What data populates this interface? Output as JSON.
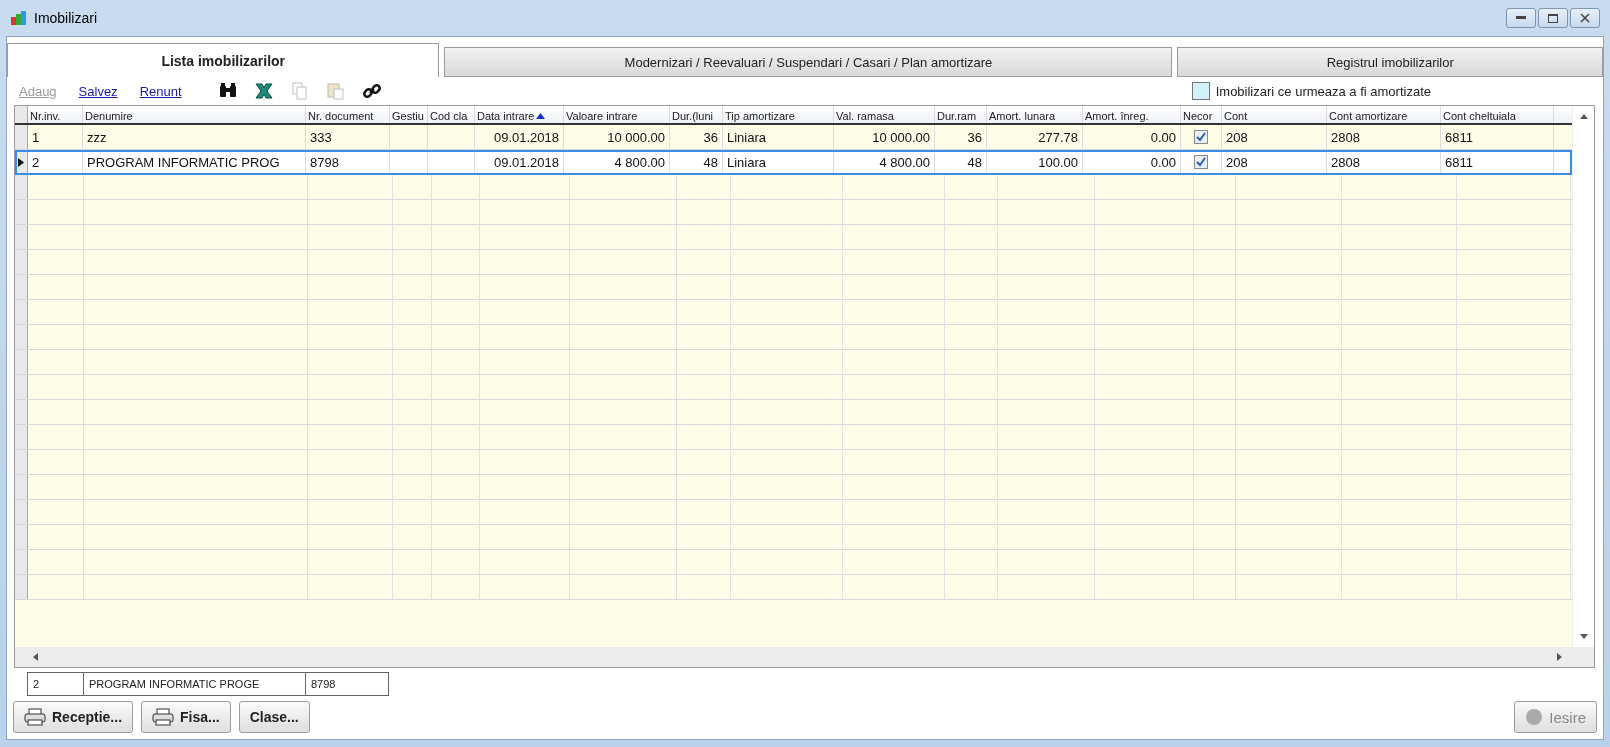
{
  "window": {
    "title": "Imobilizari"
  },
  "tabs": [
    {
      "label": "Lista imobilizarilor",
      "selected": true
    },
    {
      "label": "Modernizari / Reevaluari / Suspendari / Casari / Plan amortizare",
      "selected": false
    },
    {
      "label": "Registrul imobilizarilor",
      "selected": false
    }
  ],
  "toolbar": {
    "links": [
      {
        "label": "Adaug",
        "disabled": true
      },
      {
        "label": "Salvez",
        "disabled": false
      },
      {
        "label": "Renunt",
        "disabled": false
      }
    ],
    "icons": [
      {
        "kind": "binoculars",
        "disabled": false
      },
      {
        "kind": "excel",
        "disabled": false
      },
      {
        "kind": "copy",
        "disabled": true
      },
      {
        "kind": "paste",
        "disabled": true
      },
      {
        "kind": "link",
        "disabled": false
      }
    ],
    "legend": "Imobilizari ce urmeaza a fi amortizate"
  },
  "table": {
    "columns": [
      {
        "label": "Nr.inv.",
        "kind": "text",
        "sorted": false
      },
      {
        "label": "Denumire",
        "kind": "text",
        "sorted": false
      },
      {
        "label": "Nr. document",
        "kind": "text",
        "sorted": false
      },
      {
        "label": "Gestiu",
        "kind": "text",
        "sorted": false
      },
      {
        "label": "Cod cla",
        "kind": "text",
        "sorted": false
      },
      {
        "label": "Data intrare",
        "kind": "number",
        "sorted": true
      },
      {
        "label": "Valoare intrare",
        "kind": "number",
        "sorted": false
      },
      {
        "label": "Dur.(luni",
        "kind": "number",
        "sorted": false
      },
      {
        "label": "Tip amortizare",
        "kind": "text",
        "sorted": false
      },
      {
        "label": "Val. ramasa",
        "kind": "number",
        "sorted": false
      },
      {
        "label": "Dur.ram",
        "kind": "number",
        "sorted": false
      },
      {
        "label": "Amort. lunara",
        "kind": "number",
        "sorted": false
      },
      {
        "label": "Amort. înreg.",
        "kind": "number",
        "sorted": false
      },
      {
        "label": "Necor",
        "kind": "check",
        "sorted": false
      },
      {
        "label": "Cont",
        "kind": "text",
        "sorted": false
      },
      {
        "label": "Cont amortizare",
        "kind": "text",
        "sorted": false
      },
      {
        "label": "Cont cheltuiala",
        "kind": "text",
        "sorted": false
      }
    ],
    "rows": [
      {
        "selected": false,
        "cells": [
          "1",
          "zzz",
          "333",
          null,
          null,
          "09.01.2018",
          "10 000.00",
          "36",
          "Liniara",
          "10 000.00",
          "36",
          "277.78",
          "0.00",
          {
            "checked": true
          },
          "208",
          "2808",
          "6811"
        ]
      },
      {
        "selected": true,
        "cells": [
          "2",
          "PROGRAM INFORMATIC PROG",
          "8798",
          null,
          null,
          "09.01.2018",
          "4 800.00",
          "48",
          "Liniara",
          "4 800.00",
          "48",
          "100.00",
          "0.00",
          {
            "checked": true
          },
          "208",
          "2808",
          "6811"
        ]
      }
    ]
  },
  "summary": [
    "2",
    "PROGRAM INFORMATIC PROGE",
    "8798"
  ],
  "buttons": [
    {
      "label": "Receptie...",
      "kind": "print",
      "disabled": false
    },
    {
      "label": "Fisa...",
      "kind": "print",
      "disabled": false
    },
    {
      "label": "Clase...",
      "kind": "plain",
      "disabled": false
    }
  ],
  "exit_button": {
    "label": "Iesire",
    "disabled": true
  }
}
